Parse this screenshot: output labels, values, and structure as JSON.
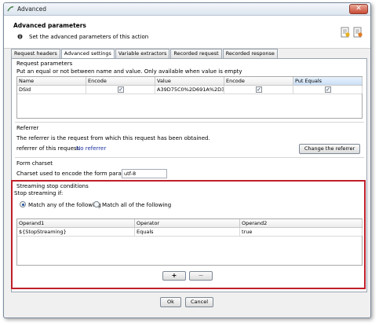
{
  "window": {
    "title": "Advanced",
    "close_symbol": "✕"
  },
  "header": {
    "title": "Advanced parameters",
    "subtitle": "Set the advanced parameters of this action"
  },
  "tabs": [
    {
      "label": "Request headers",
      "active": false
    },
    {
      "label": "Advanced settings",
      "active": true
    },
    {
      "label": "Variable extractors",
      "active": false
    },
    {
      "label": "Recorded request",
      "active": false
    },
    {
      "label": "Recorded response",
      "active": false
    }
  ],
  "request_params": {
    "title": "Request parameters",
    "hint": "Put an equal or not between name and value. Only available when value is empty",
    "columns": [
      "Name",
      "Encode",
      "Value",
      "Encode",
      "Put Equals"
    ],
    "rows": [
      {
        "name": "DSId",
        "encode1": true,
        "value": "A39D75C0%2D691A%2D3...",
        "encode2": true,
        "put_equals": true
      }
    ]
  },
  "referrer": {
    "title": "Referrer",
    "description": "The referrer is the request from which this request has been obtained.",
    "label": "referrer of this request:",
    "value": "No referrer",
    "button": "Change the referrer"
  },
  "form_charset": {
    "title": "Form charset",
    "label": "Charset used to encode the form parameters:",
    "value": "utf-8"
  },
  "streaming": {
    "title": "Streaming stop conditions",
    "stop_if": "Stop streaming if:",
    "match_any": "Match any of the following",
    "match_all": "Match all of the following",
    "selected": "any",
    "columns": [
      "Operand1",
      "Operator",
      "Operand2"
    ],
    "rows": [
      {
        "operand1": "${StopStreaming}",
        "operator": "Equals",
        "operand2": "true"
      }
    ],
    "add_button": "+",
    "remove_button": "−"
  },
  "footer": {
    "ok": "Ok",
    "cancel": "Cancel"
  },
  "colors": {
    "highlight": "#c0202a",
    "link": "#1a2ea0"
  }
}
